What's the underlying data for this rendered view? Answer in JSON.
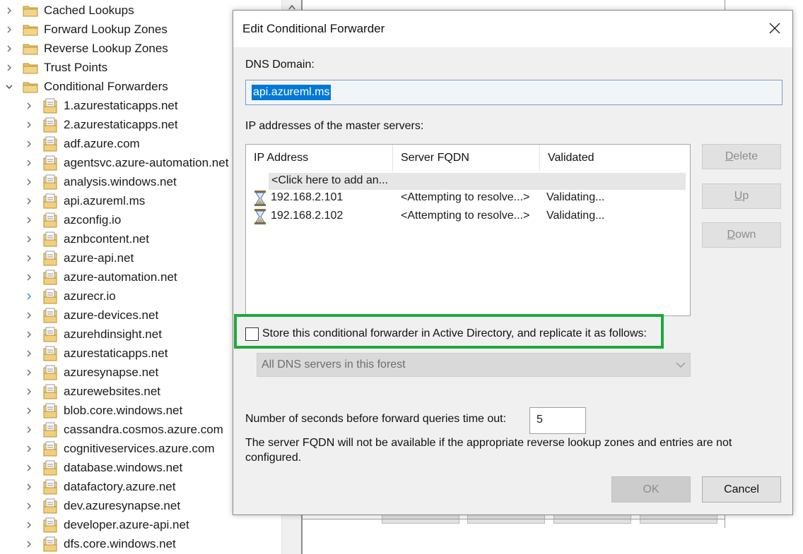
{
  "tree": {
    "top_items": [
      {
        "label": "Cached Lookups",
        "expanded": false
      },
      {
        "label": "Forward Lookup Zones",
        "expanded": false
      },
      {
        "label": "Reverse Lookup Zones",
        "expanded": false
      },
      {
        "label": "Trust Points",
        "expanded": false
      },
      {
        "label": "Conditional Forwarders",
        "expanded": true
      }
    ],
    "forwarders": [
      "1.azurestaticapps.net",
      "2.azurestaticapps.net",
      "adf.azure.com",
      "agentsvc.azure-automation.net",
      "analysis.windows.net",
      "api.azureml.ms",
      "azconfig.io",
      "aznbcontent.net",
      "azure-api.net",
      "azure-automation.net",
      "azurecr.io",
      "azure-devices.net",
      "azurehdinsight.net",
      "azurestaticapps.net",
      "azuresynapse.net",
      "azurewebsites.net",
      "blob.core.windows.net",
      "cassandra.cosmos.azure.com",
      "cognitiveservices.azure.com",
      "database.windows.net",
      "datafactory.azure.net",
      "dev.azuresynapse.net",
      "developer.azure-api.net",
      "dfs.core.windows.net"
    ],
    "hovered_index": 10
  },
  "dialog": {
    "title": "Edit Conditional Forwarder",
    "dns_domain_label": "DNS Domain:",
    "dns_domain_value": "api.azureml.ms",
    "ip_section_label": "IP addresses of the master servers:",
    "columns": [
      "IP Address",
      "Server FQDN",
      "Validated"
    ],
    "add_row_text": "<Click here to add an...",
    "rows": [
      {
        "ip": "192.168.2.101",
        "fqdn": "<Attempting to resolve...>",
        "validated": "Validating..."
      },
      {
        "ip": "192.168.2.102",
        "fqdn": "<Attempting to resolve...>",
        "validated": "Validating..."
      }
    ],
    "buttons": {
      "delete": {
        "mnemonic": "D",
        "rest": "elete"
      },
      "up": {
        "mnemonic": "U",
        "rest": "p"
      },
      "down": {
        "mnemonic": "D",
        "rest": "own"
      },
      "ok": "OK",
      "cancel": "Cancel"
    },
    "store_in_ad_label": "Store this conditional forwarder in Active Directory, and replicate it as follows:",
    "store_in_ad_checked": false,
    "replication_value": "All DNS servers in this forest",
    "timeout_label": "Number of seconds before forward queries time out:",
    "timeout_value": "5",
    "note": "The server FQDN will not be available if the appropriate reverse lookup zones and entries are not configured."
  },
  "colors": {
    "selection": "#0078d7",
    "highlight_frame": "#1fa83a",
    "dialog_bg": "#f0f0f0",
    "disabled_text": "#8d8d8d",
    "folder": "#e8c36a"
  }
}
